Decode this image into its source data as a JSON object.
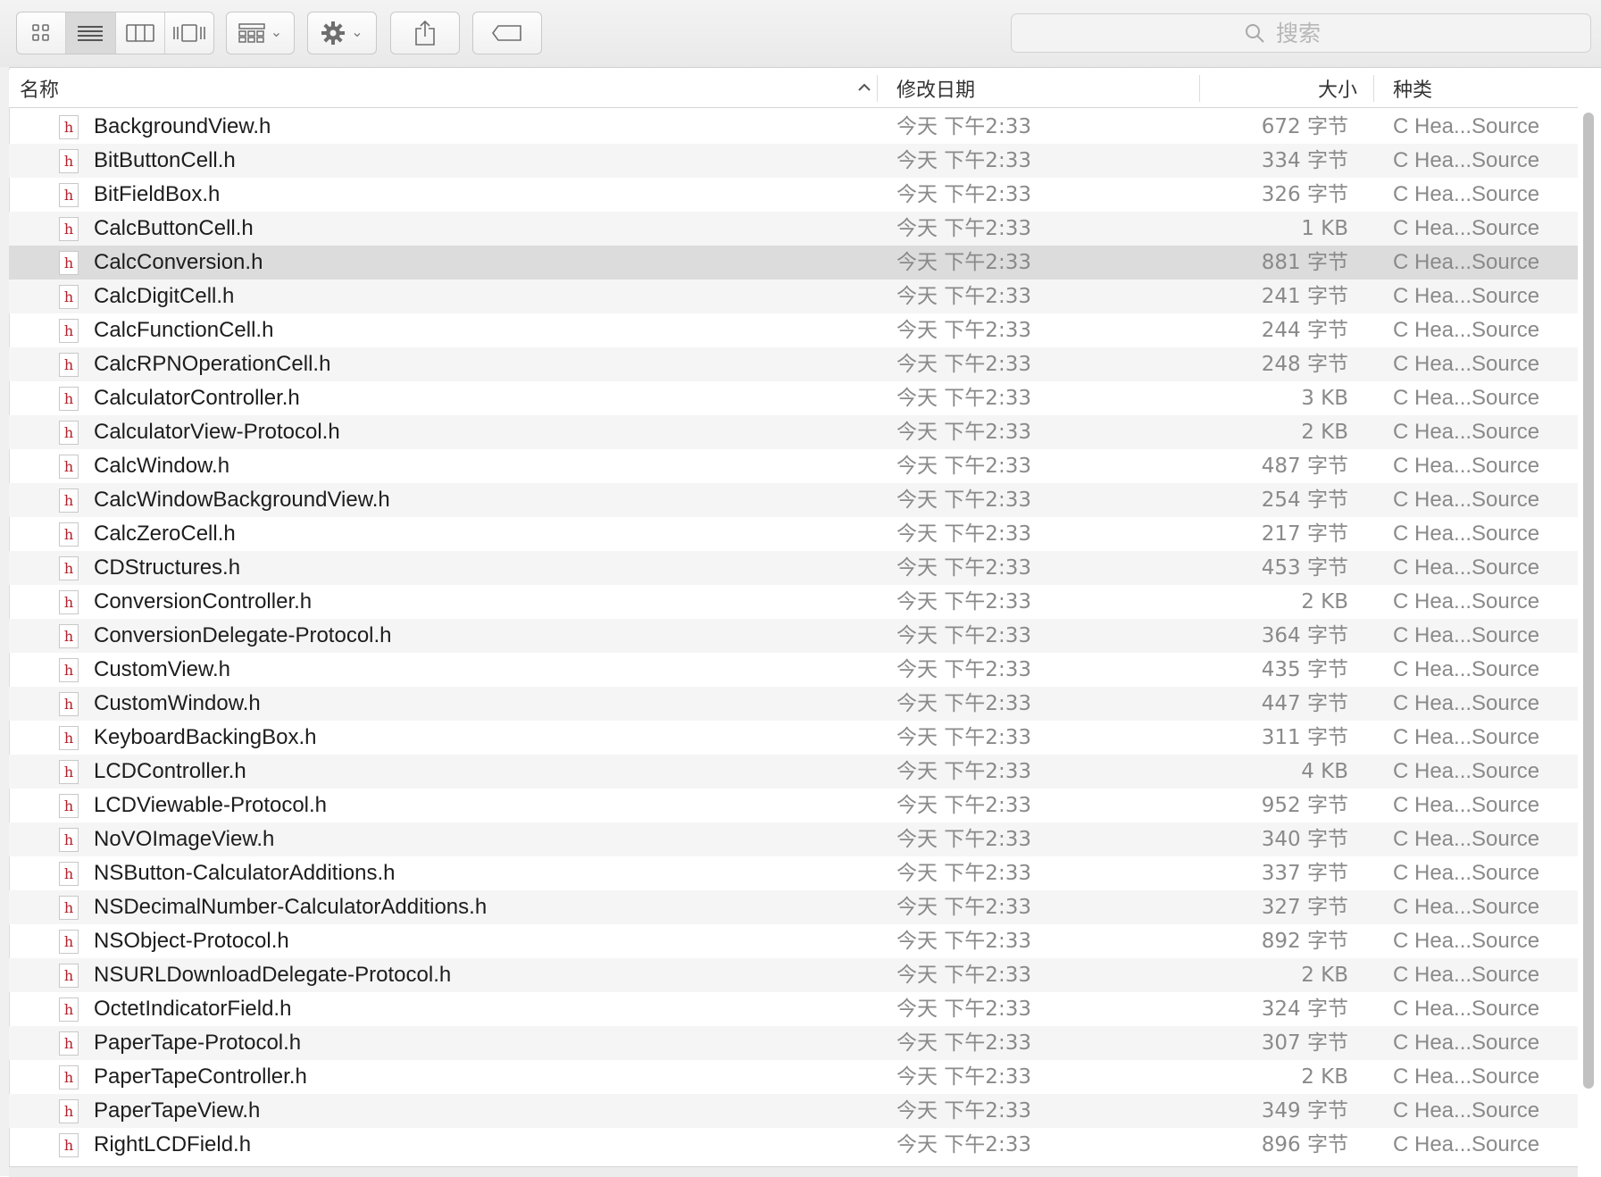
{
  "toolbar": {
    "view_modes": [
      {
        "icon": "icon-view-icon",
        "active": false
      },
      {
        "icon": "list-view-icon",
        "active": true
      },
      {
        "icon": "column-view-icon",
        "active": false
      },
      {
        "icon": "cover-flow-icon",
        "active": false
      }
    ],
    "arrange_icon": "arrange-grid-icon",
    "action_icon": "gear-icon",
    "share_icon": "share-icon",
    "tag_icon": "tag-icon",
    "search_placeholder": "搜索"
  },
  "columns": {
    "name": "名称",
    "date": "修改日期",
    "size": "大小",
    "kind": "种类"
  },
  "sort": {
    "column": "name",
    "direction": "ascending"
  },
  "file_icon_label": "h",
  "files": [
    {
      "name": "BackgroundView.h",
      "date": "今天 下午2:33",
      "size": "672 字节",
      "kind": "C Hea...Source"
    },
    {
      "name": "BitButtonCell.h",
      "date": "今天 下午2:33",
      "size": "334 字节",
      "kind": "C Hea...Source"
    },
    {
      "name": "BitFieldBox.h",
      "date": "今天 下午2:33",
      "size": "326 字节",
      "kind": "C Hea...Source"
    },
    {
      "name": "CalcButtonCell.h",
      "date": "今天 下午2:33",
      "size": "1 KB",
      "kind": "C Hea...Source"
    },
    {
      "name": "CalcConversion.h",
      "date": "今天 下午2:33",
      "size": "881 字节",
      "kind": "C Hea...Source",
      "selected": true
    },
    {
      "name": "CalcDigitCell.h",
      "date": "今天 下午2:33",
      "size": "241 字节",
      "kind": "C Hea...Source"
    },
    {
      "name": "CalcFunctionCell.h",
      "date": "今天 下午2:33",
      "size": "244 字节",
      "kind": "C Hea...Source"
    },
    {
      "name": "CalcRPNOperationCell.h",
      "date": "今天 下午2:33",
      "size": "248 字节",
      "kind": "C Hea...Source"
    },
    {
      "name": "CalculatorController.h",
      "date": "今天 下午2:33",
      "size": "3 KB",
      "kind": "C Hea...Source"
    },
    {
      "name": "CalculatorView-Protocol.h",
      "date": "今天 下午2:33",
      "size": "2 KB",
      "kind": "C Hea...Source"
    },
    {
      "name": "CalcWindow.h",
      "date": "今天 下午2:33",
      "size": "487 字节",
      "kind": "C Hea...Source"
    },
    {
      "name": "CalcWindowBackgroundView.h",
      "date": "今天 下午2:33",
      "size": "254 字节",
      "kind": "C Hea...Source"
    },
    {
      "name": "CalcZeroCell.h",
      "date": "今天 下午2:33",
      "size": "217 字节",
      "kind": "C Hea...Source"
    },
    {
      "name": "CDStructures.h",
      "date": "今天 下午2:33",
      "size": "453 字节",
      "kind": "C Hea...Source"
    },
    {
      "name": "ConversionController.h",
      "date": "今天 下午2:33",
      "size": "2 KB",
      "kind": "C Hea...Source"
    },
    {
      "name": "ConversionDelegate-Protocol.h",
      "date": "今天 下午2:33",
      "size": "364 字节",
      "kind": "C Hea...Source"
    },
    {
      "name": "CustomView.h",
      "date": "今天 下午2:33",
      "size": "435 字节",
      "kind": "C Hea...Source"
    },
    {
      "name": "CustomWindow.h",
      "date": "今天 下午2:33",
      "size": "447 字节",
      "kind": "C Hea...Source"
    },
    {
      "name": "KeyboardBackingBox.h",
      "date": "今天 下午2:33",
      "size": "311 字节",
      "kind": "C Hea...Source"
    },
    {
      "name": "LCDController.h",
      "date": "今天 下午2:33",
      "size": "4 KB",
      "kind": "C Hea...Source"
    },
    {
      "name": "LCDViewable-Protocol.h",
      "date": "今天 下午2:33",
      "size": "952 字节",
      "kind": "C Hea...Source"
    },
    {
      "name": "NoVOImageView.h",
      "date": "今天 下午2:33",
      "size": "340 字节",
      "kind": "C Hea...Source"
    },
    {
      "name": "NSButton-CalculatorAdditions.h",
      "date": "今天 下午2:33",
      "size": "337 字节",
      "kind": "C Hea...Source"
    },
    {
      "name": "NSDecimalNumber-CalculatorAdditions.h",
      "date": "今天 下午2:33",
      "size": "327 字节",
      "kind": "C Hea...Source"
    },
    {
      "name": "NSObject-Protocol.h",
      "date": "今天 下午2:33",
      "size": "892 字节",
      "kind": "C Hea...Source"
    },
    {
      "name": "NSURLDownloadDelegate-Protocol.h",
      "date": "今天 下午2:33",
      "size": "2 KB",
      "kind": "C Hea...Source"
    },
    {
      "name": "OctetIndicatorField.h",
      "date": "今天 下午2:33",
      "size": "324 字节",
      "kind": "C Hea...Source"
    },
    {
      "name": "PaperTape-Protocol.h",
      "date": "今天 下午2:33",
      "size": "307 字节",
      "kind": "C Hea...Source"
    },
    {
      "name": "PaperTapeController.h",
      "date": "今天 下午2:33",
      "size": "2 KB",
      "kind": "C Hea...Source"
    },
    {
      "name": "PaperTapeView.h",
      "date": "今天 下午2:33",
      "size": "349 字节",
      "kind": "C Hea...Source"
    },
    {
      "name": "RightLCDField.h",
      "date": "今天 下午2:33",
      "size": "896 字节",
      "kind": "C Hea...Source"
    }
  ]
}
